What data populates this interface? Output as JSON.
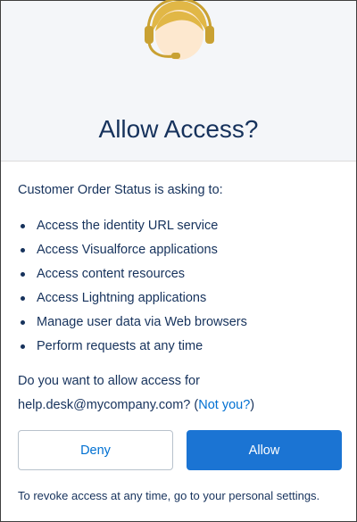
{
  "dialog": {
    "title": "Allow Access?",
    "intro": "Customer Order Status is asking to:",
    "permissions": [
      "Access the identity URL service",
      "Access Visualforce applications",
      "Access content resources",
      "Access Lightning applications",
      "Manage user data via Web browsers",
      "Perform requests at any time"
    ],
    "question_prefix": "Do you want to allow access for",
    "account": "help.desk@mycompany.com?",
    "not_you_open": "(",
    "not_you_label": "Not you?",
    "not_you_close": ")",
    "deny_label": "Deny",
    "allow_label": "Allow",
    "footer_note": "To revoke access at any time, go to your personal settings."
  },
  "icons": {
    "avatar": "headset-agent-avatar-icon"
  },
  "colors": {
    "title_text": "#16325c",
    "link": "#0070d2",
    "allow_button": "#1b74d3",
    "header_background": "#f4f6f9",
    "avatar_hair": "#e1b746",
    "avatar_skin": "#fde8cf"
  }
}
